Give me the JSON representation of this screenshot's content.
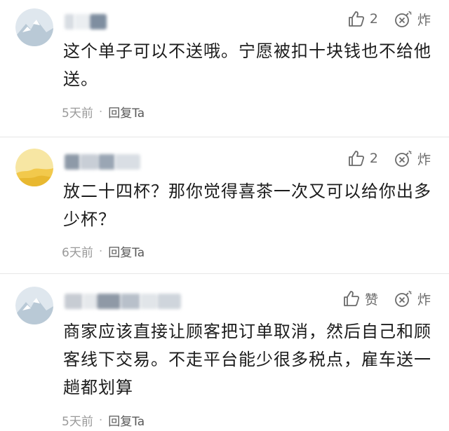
{
  "comments": [
    {
      "likes": "2",
      "bomb_label": "炸",
      "text": "这个单子可以不送哦。宁愿被扣十块钱也不给他送。",
      "time": "5天前",
      "separator": "·",
      "reply": "回复Ta"
    },
    {
      "likes": "2",
      "bomb_label": "炸",
      "text": "放二十四杯？那你觉得喜茶一次又可以给你出多少杯？",
      "time": "6天前",
      "separator": "·",
      "reply": "回复Ta"
    },
    {
      "likes": "赞",
      "bomb_label": "炸",
      "text": "商家应该直接让顾客把订单取消，然后自己和顾客线下交易。不走平台能少很多税点，雇车送一趟都划算",
      "time": "5天前",
      "separator": "·",
      "reply": "回复Ta"
    }
  ],
  "colors": {
    "text": "#1c1c1c",
    "meta": "#9a9a9a",
    "icon": "#6b6b6b"
  }
}
